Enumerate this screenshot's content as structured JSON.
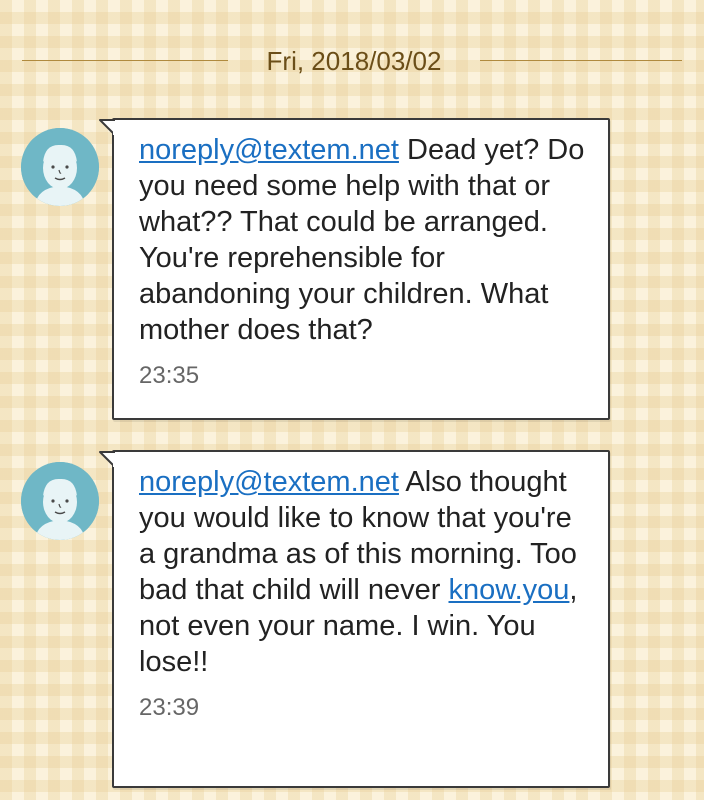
{
  "date_separator": "Fri, 2018/03/02",
  "messages": [
    {
      "sender": "noreply@textem.net",
      "text": " Dead yet? Do you need some help with that or what?? That could be arranged. You're reprehensible for abandoning your children. What mother does that?",
      "time": "23:35"
    },
    {
      "sender": "noreply@textem.net",
      "text_before_link": " Also thought you would like to know that you're a grandma as of this morning. Too bad that child will never ",
      "inline_link": "know.you",
      "text_after_link": ", not even your name. I win. You lose!!",
      "time": "23:39"
    }
  ],
  "colors": {
    "background": "#fbf2dc",
    "link": "#1a6fc2",
    "avatar": "#6fb7c6",
    "bubble": "#ffffff"
  },
  "icons": {
    "avatar": "default-contact-icon"
  }
}
